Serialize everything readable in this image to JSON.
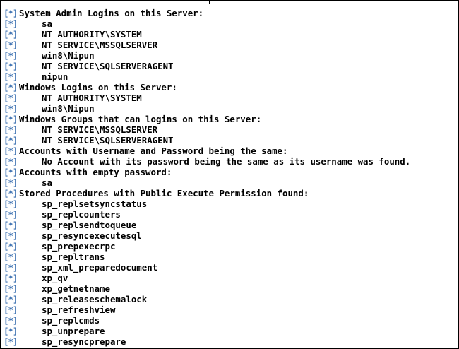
{
  "terminal": {
    "marker": "[*]",
    "lines": [
      {
        "text": "System Admin Logins on this Server:",
        "indent": false
      },
      {
        "text": "sa",
        "indent": true
      },
      {
        "text": "NT AUTHORITY\\SYSTEM",
        "indent": true
      },
      {
        "text": "NT SERVICE\\MSSQLSERVER",
        "indent": true
      },
      {
        "text": "win8\\Nipun",
        "indent": true
      },
      {
        "text": "NT SERVICE\\SQLSERVERAGENT",
        "indent": true
      },
      {
        "text": "nipun",
        "indent": true
      },
      {
        "text": "Windows Logins on this Server:",
        "indent": false
      },
      {
        "text": "NT AUTHORITY\\SYSTEM",
        "indent": true
      },
      {
        "text": "win8\\Nipun",
        "indent": true
      },
      {
        "text": "Windows Groups that can logins on this Server:",
        "indent": false
      },
      {
        "text": "NT SERVICE\\MSSQLSERVER",
        "indent": true
      },
      {
        "text": "NT SERVICE\\SQLSERVERAGENT",
        "indent": true
      },
      {
        "text": "Accounts with Username and Password being the same:",
        "indent": false
      },
      {
        "text": "No Account with its password being the same as its username was found.",
        "indent": true
      },
      {
        "text": "Accounts with empty password:",
        "indent": false
      },
      {
        "text": "sa",
        "indent": true
      },
      {
        "text": "Stored Procedures with Public Execute Permission found:",
        "indent": false
      },
      {
        "text": "sp_replsetsyncstatus",
        "indent": true
      },
      {
        "text": "sp_replcounters",
        "indent": true
      },
      {
        "text": "sp_replsendtoqueue",
        "indent": true
      },
      {
        "text": "sp_resyncexecutesql",
        "indent": true
      },
      {
        "text": "sp_prepexecrpc",
        "indent": true
      },
      {
        "text": "sp_repltrans",
        "indent": true
      },
      {
        "text": "sp_xml_preparedocument",
        "indent": true
      },
      {
        "text": "xp_qv",
        "indent": true
      },
      {
        "text": "xp_getnetname",
        "indent": true
      },
      {
        "text": "sp_releaseschemalock",
        "indent": true
      },
      {
        "text": "sp_refreshview",
        "indent": true
      },
      {
        "text": "sp_replcmds",
        "indent": true
      },
      {
        "text": "sp_unprepare",
        "indent": true
      },
      {
        "text": "sp_resyncprepare",
        "indent": true
      }
    ]
  },
  "colors": {
    "marker": "#3a6fb0",
    "text": "#000000",
    "background": "#ffffff"
  }
}
